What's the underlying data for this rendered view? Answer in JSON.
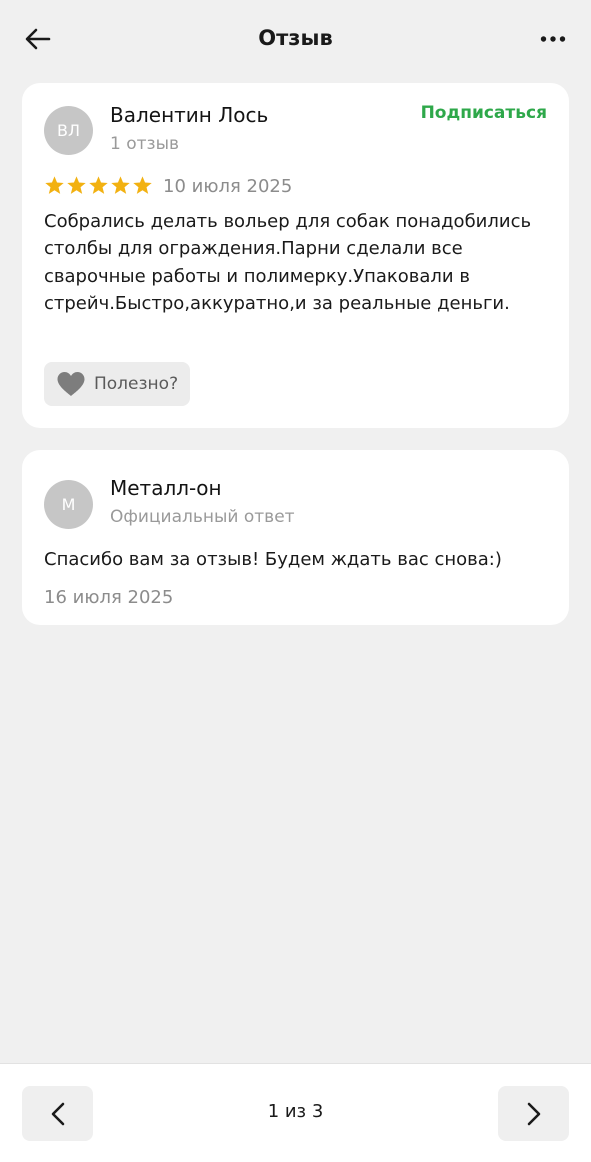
{
  "header": {
    "title": "Отзыв",
    "back_icon": "arrow-left-icon",
    "more_icon": "more-horizontal-icon"
  },
  "review": {
    "author_initials": "ВЛ",
    "author_name": "Валентин Лось",
    "author_reviews": "1 отзыв",
    "subscribe_label": "Подписаться",
    "rating": 5,
    "rating_max": 5,
    "date": "10 июля 2025",
    "text": "Собрались делать вольер для собак понадобились столбы для ограждения.Парни сделали все сварочные работы и полимерку.Упаковали в стрейч.Быстро,аккуратно,и за реальные деньги.",
    "useful_label": "Полезно?",
    "useful_icon": "heart-icon"
  },
  "reply": {
    "author_initials": "М",
    "author_name": "Металл-он",
    "author_role": "Официальный ответ",
    "text": "Спасибо вам за отзыв! Будем ждать вас снова:)",
    "date": "16 июля 2025"
  },
  "pager": {
    "label": "1 из 3",
    "prev_icon": "chevron-left-icon",
    "next_icon": "chevron-right-icon"
  },
  "colors": {
    "accent_green": "#2ea84a",
    "star_gold": "#f2b111",
    "background": "#f0f0f0",
    "avatar_gray": "#c6c6c6"
  }
}
